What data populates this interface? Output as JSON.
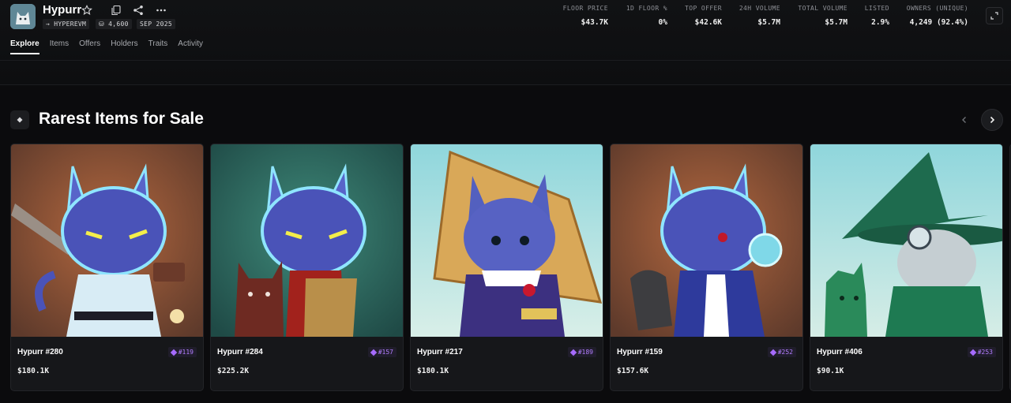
{
  "collection": {
    "name": "Hypurr",
    "chain": "→ HYPEREVM",
    "supply": "4,600",
    "date": "SEP 2025"
  },
  "icons": {
    "favorite": "star-icon",
    "copy": "copy-icon",
    "share": "share-icon",
    "more": "more-icon",
    "expand": "expand-icon",
    "section": "diamond-icon",
    "prev": "chevron-left-icon",
    "next": "chevron-right-icon",
    "rarity": "gem-icon"
  },
  "stats": [
    {
      "label": "FLOOR PRICE",
      "value": "$43.7K"
    },
    {
      "label": "1D FLOOR %",
      "value": "0%"
    },
    {
      "label": "TOP OFFER",
      "value": "$42.6K"
    },
    {
      "label": "24H VOLUME",
      "value": "$5.7M"
    },
    {
      "label": "TOTAL VOLUME",
      "value": "$5.7M"
    },
    {
      "label": "LISTED",
      "value": "2.9%"
    },
    {
      "label": "OWNERS (UNIQUE)",
      "value": "4,249 (92.4%)"
    }
  ],
  "tabs": [
    "Explore",
    "Items",
    "Offers",
    "Holders",
    "Traits",
    "Activity"
  ],
  "active_tab": "Explore",
  "section": {
    "title": "Rarest Items for Sale"
  },
  "colors": {
    "accent_purple": "#a66bff",
    "background": "#0b0b0d"
  },
  "items": [
    {
      "name": "Hypurr #280",
      "rank": "#119",
      "price": "$180.1K"
    },
    {
      "name": "Hypurr #284",
      "rank": "#157",
      "price": "$225.2K"
    },
    {
      "name": "Hypurr #217",
      "rank": "#189",
      "price": "$180.1K"
    },
    {
      "name": "Hypurr #159",
      "rank": "#252",
      "price": "$157.6K"
    },
    {
      "name": "Hypurr #406",
      "rank": "#253",
      "price": "$90.1K"
    }
  ]
}
